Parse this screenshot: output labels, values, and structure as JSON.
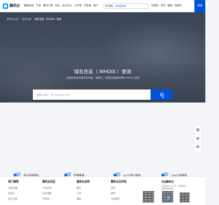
{
  "nav": {
    "logo_text": "腾讯云",
    "items": [
      "最新活动",
      "产品",
      "解决方案",
      "定价",
      "企业中心",
      "云市场",
      "开发者",
      "客户"
    ],
    "search_query": "搜索",
    "search_hint": "DeepSeek",
    "right_items": [
      "中国站",
      "文档",
      "备案",
      "控制台"
    ],
    "signin_label": "登录"
  },
  "breadcrumb": [
    "腾讯云主页",
    "域名注册",
    "域名信息（WHOIS）查询"
  ],
  "hero": {
    "title": "域名信息（ WHOIS ）查询",
    "subtitle": "注册信息查询域名所有者、到期日、资源注册服务商等 WHOIS 信息",
    "input_placeholder": "请输入域名，如: example.com"
  },
  "features": [
    {
      "label": "多元优质服务"
    },
    {
      "label": "免费备案"
    },
    {
      "label": "1V1大客户服务"
    },
    {
      "label": "7x24小时服务"
    }
  ],
  "footer": {
    "columns": [
      {
        "head": "热门推荐",
        "links": [
          "云服务器",
          "轻量云",
          "域名注册",
          "云数据库",
          "云存储"
        ]
      },
      {
        "head": "腾讯云社区",
        "links": [
          "产品文档",
          "技术博客",
          "开发者",
          "学习中心"
        ]
      },
      {
        "head": "服务与支持",
        "links": [
          "服务",
          "工单",
          "备案",
          "安全中心"
        ]
      },
      {
        "head": "腾讯云云市场",
        "links": [
          "应用",
          "镜像",
          "专家服务",
          "解决方案"
        ]
      }
    ],
    "qr_title": "关注腾讯云",
    "qr_sub": "扫码关注公众号，获取最新",
    "qr_sub2": "优惠活动信息"
  },
  "colors": {
    "brand_blue": "#0052d9",
    "hero_bg": "#414b5a",
    "accent_blue": "#1f6ee8"
  }
}
